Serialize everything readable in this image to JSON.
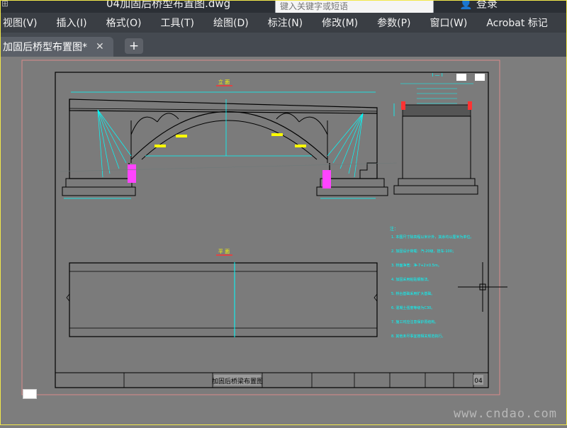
{
  "titlebar": {
    "doc_title": "04加固后桥型布置图.dwg",
    "search_placeholder": "键入关键字或短语",
    "login": "登录"
  },
  "menu": [
    "视图(V)",
    "插入(I)",
    "格式(O)",
    "工具(T)",
    "绘图(D)",
    "标注(N)",
    "修改(M)",
    "参数(P)",
    "窗口(W)",
    "Acrobat 标记"
  ],
  "tab": {
    "label": "加固后桥型布置图*",
    "close": "✕",
    "new": "+"
  },
  "drawing": {
    "elevation_title": "立 面",
    "plan_title": "平 面",
    "section_title": "I — I",
    "sheet_title": "加固后桥梁布置图",
    "page_no": "04",
    "notes_title": "注：",
    "notes": [
      "1. 本图尺寸除高程以米计外，其余均以厘米为单位。",
      "2. 加固设计荷载：汽-20级，挂车-100；",
      "3. 桥面净宽：净-7+2×0.5m。",
      "4. 加固采用粘贴钢板法。",
      "5. 桥台基础采用扩大基础。",
      "6. 混凝土强度等级为C30。",
      "7. 施工时应注意保护原结构。",
      "8. 其他未尽事宜按相关规范执行。"
    ]
  },
  "watermark": "www.cndao.com",
  "colors": {
    "menubar": "#3a3e44",
    "canvas": "#7d7d7d",
    "cyan": "#00ffff",
    "magenta": "#ff33ff",
    "yellow": "#ffff00",
    "red": "#ff3333"
  }
}
